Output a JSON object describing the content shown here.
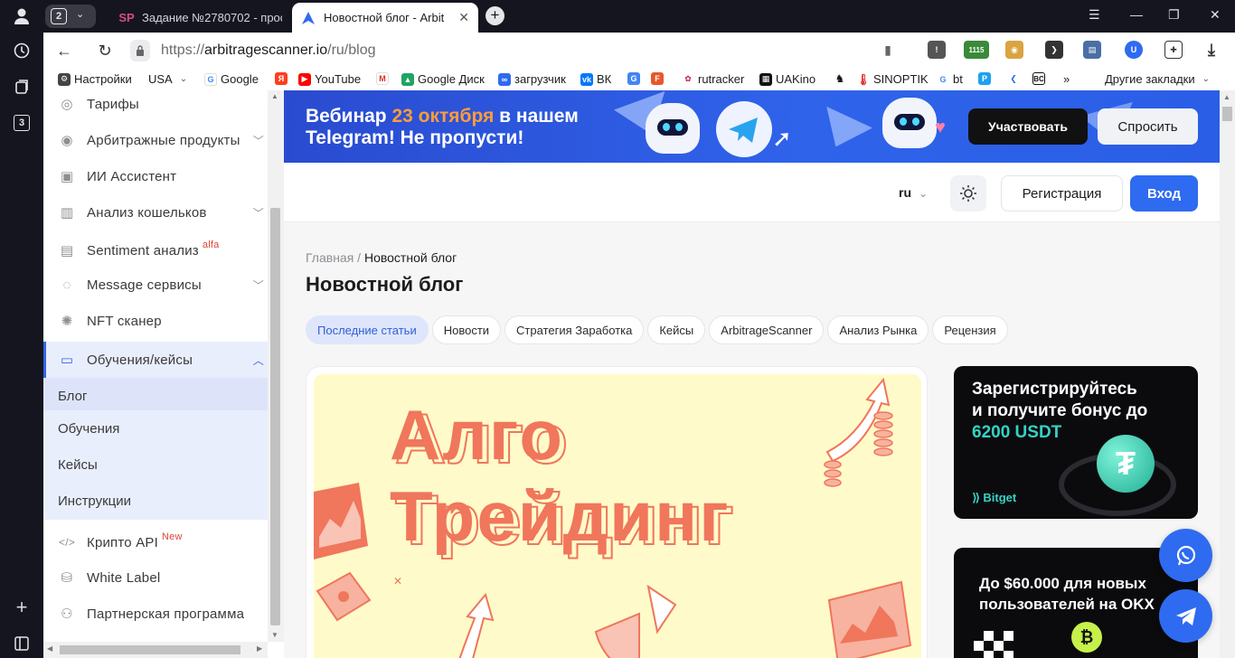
{
  "browser": {
    "tab_count": "2",
    "tabs": [
      {
        "favicon": "SP",
        "title": "Задание №2780702 - прос"
      },
      {
        "favicon": "arbitrage-logo",
        "title": "Новостной блог - Arbit"
      }
    ],
    "url_scheme": "https://",
    "url_host": "arbitragescanner.io",
    "url_path": "/ru/blog",
    "side_panel_badge": "3",
    "ext_counter": "1115",
    "bookmarks": [
      {
        "label": "Настройки"
      },
      {
        "label": "USA"
      },
      {
        "label": "Google"
      },
      {
        "label": ""
      },
      {
        "label": "YouTube"
      },
      {
        "label": ""
      },
      {
        "label": "Google Диск"
      },
      {
        "label": "загрузчик"
      },
      {
        "label": "ВК"
      },
      {
        "label": ""
      },
      {
        "label": ""
      },
      {
        "label": "rutracker"
      },
      {
        "label": "UAKino"
      },
      {
        "label": ""
      },
      {
        "label": "SINOPTIK"
      },
      {
        "label": "bt"
      }
    ],
    "bookmarks_more": "»",
    "other_bookmarks": "Другие закладки"
  },
  "sidebar": {
    "items": [
      {
        "label": "Тарифы",
        "badge": "",
        "has_chevron": false
      },
      {
        "label": "Арбитражные продукты",
        "badge": "",
        "has_chevron": true
      },
      {
        "label": "ИИ Ассистент",
        "badge": "",
        "has_chevron": false
      },
      {
        "label": "Анализ кошельков",
        "badge": "",
        "has_chevron": true
      },
      {
        "label": "Sentiment анализ",
        "badge": "alfa",
        "has_chevron": false
      },
      {
        "label": "Message сервисы",
        "badge": "",
        "has_chevron": true
      },
      {
        "label": "NFT сканер",
        "badge": "",
        "has_chevron": false
      },
      {
        "label": "Обучения/кейсы",
        "badge": "",
        "has_chevron": true
      }
    ],
    "sub_items": [
      "Блог",
      "Обучения",
      "Кейсы",
      "Инструкции"
    ],
    "bottom_items": [
      {
        "label": "Крипто API",
        "badge": "New"
      },
      {
        "label": "White Label",
        "badge": ""
      },
      {
        "label": "Партнерская программа",
        "badge": ""
      }
    ]
  },
  "banner": {
    "line1_a": "Вебинар ",
    "line1_date": "23 октября",
    "line1_b": " в нашем",
    "line2": "Telegram! Не пропусти!",
    "join_label": "Участвовать",
    "ask_label": "Спросить"
  },
  "header": {
    "lang": "ru",
    "register_label": "Регистрация",
    "login_label": "Вход"
  },
  "breadcrumb": {
    "home": "Главная",
    "sep": " / ",
    "current": "Новостной блог"
  },
  "page_title": "Новостной блог",
  "categories": [
    "Последние статьи",
    "Новости",
    "Стратегия Заработка",
    "Кейсы",
    "ArbitrageScanner",
    "Анализ Рынка",
    "Рецензия"
  ],
  "article": {
    "cover_word1": "Алго",
    "cover_word2": "Трейдинг"
  },
  "ads": {
    "bitget_line1": "Зарегистрируйтесь",
    "bitget_line2": "и получите бонус до",
    "bitget_amount": "6200 USDT",
    "bitget_brand": "Bitget",
    "okx_line1": "До $60.000 для новых",
    "okx_line2": "пользователей на OKX"
  },
  "colors": {
    "accent": "#2f6bf0",
    "sidebar_active_bg": "#e9eefc",
    "cover_bg": "#fffac9",
    "cover_text": "#f0765c"
  }
}
